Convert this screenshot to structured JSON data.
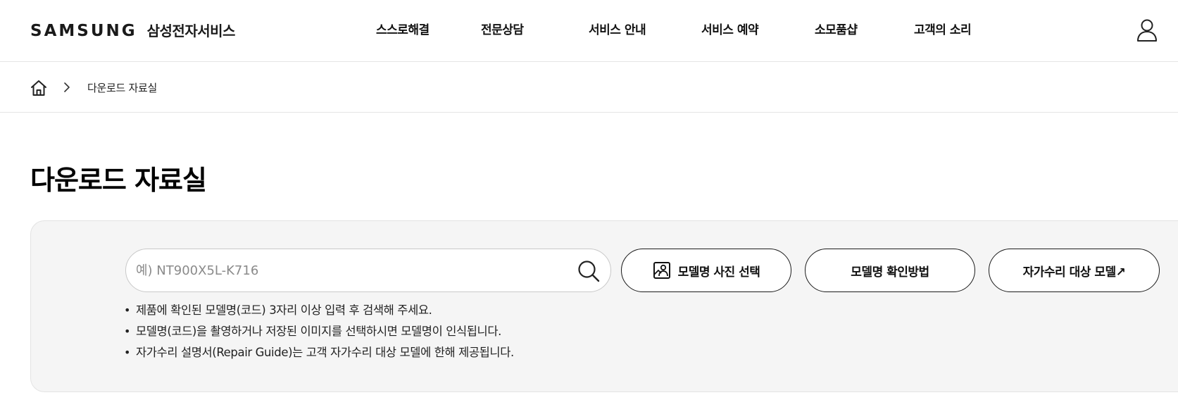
{
  "header": {
    "brand_logo": "SAMSUNG",
    "brand_sub": "삼성전자서비스",
    "nav": [
      {
        "label": "스스로해결"
      },
      {
        "label": "전문상담"
      },
      {
        "label": "서비스 안내"
      },
      {
        "label": "서비스 예약"
      },
      {
        "label": "소모품샵"
      },
      {
        "label": "고객의 소리"
      }
    ],
    "user_icon": "user-icon"
  },
  "breadcrumb": {
    "home_icon": "home-icon",
    "current": "다운로드 자료실"
  },
  "page": {
    "title": "다운로드 자료실"
  },
  "search": {
    "placeholder": "예) NT900X5L-K716",
    "value": "",
    "icon": "search-icon"
  },
  "buttons": {
    "photo_select": "모델명 사진 선택",
    "how_to_check": "모델명 확인방법",
    "self_repair": "자가수리 대상 모델↗"
  },
  "notes": [
    "제품에 확인된 모델명(코드) 3자리 이상 입력 후 검색해 주세요.",
    "모델명(코드)을 촬영하거나 저장된 이미지를 선택하시면 모델명이 인식됩니다.",
    "자가수리 설명서(Repair Guide)는 고객 자가수리 대상 모델에 한해 제공됩니다."
  ],
  "colors": {
    "panel_bg": "#f5f5f5",
    "border": "#1a1a1a",
    "placeholder": "#8a8a8a"
  }
}
